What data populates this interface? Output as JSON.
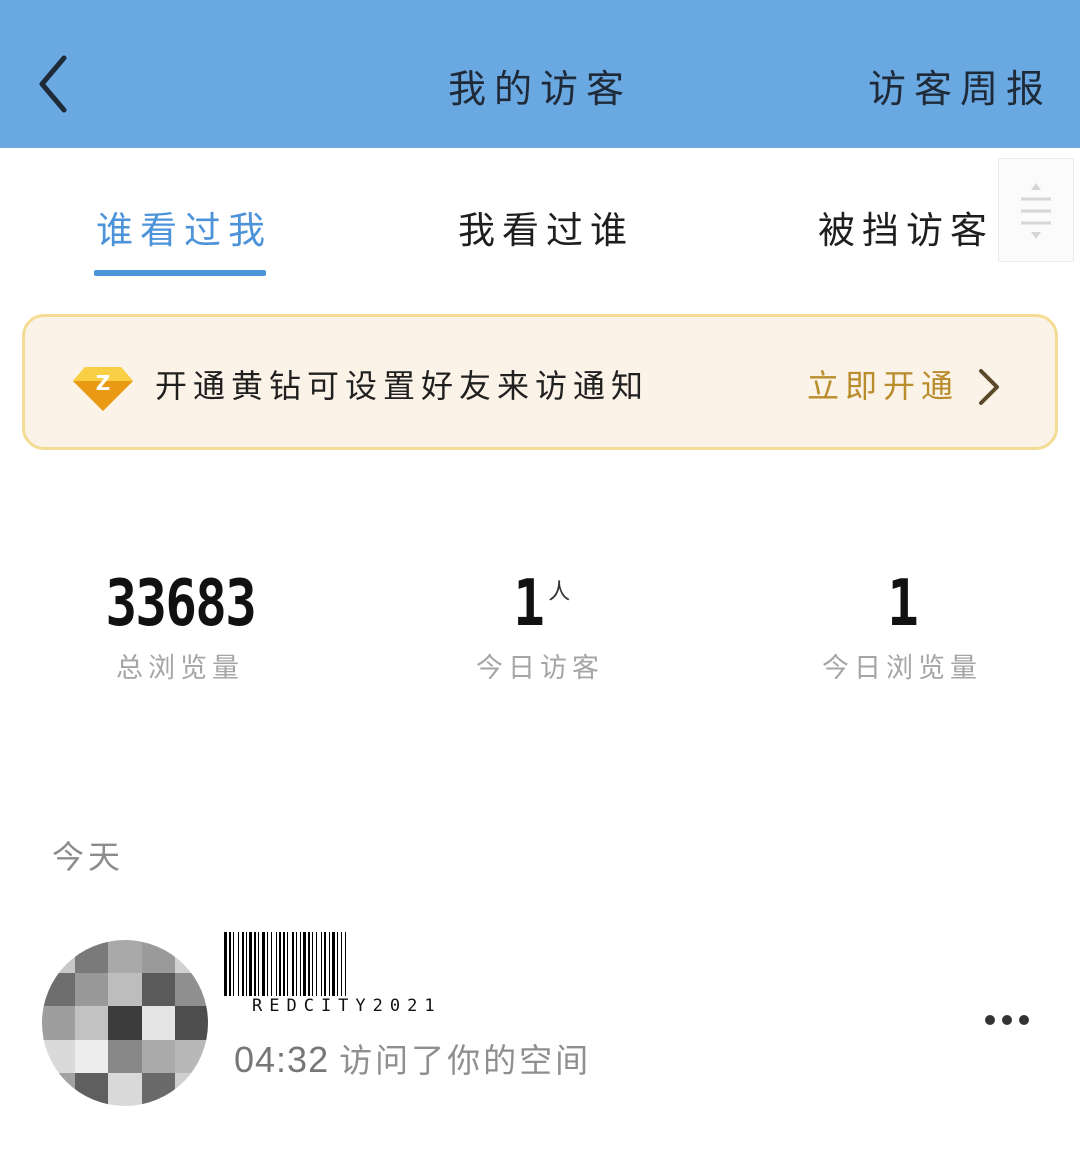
{
  "header": {
    "title": "我的访客",
    "right_action": "访客周报",
    "background": "#6aa8e2"
  },
  "tabs": [
    {
      "label": "谁看过我",
      "active": true
    },
    {
      "label": "我看过谁",
      "active": false
    },
    {
      "label": "被挡访客",
      "active": false
    }
  ],
  "banner": {
    "text": "开通黄钻可设置好友来访通知",
    "action": "立即开通",
    "accent": "#b98c2c"
  },
  "stats": [
    {
      "value": "33683",
      "unit": "",
      "label": "总浏览量"
    },
    {
      "value": "1",
      "unit": "人",
      "label": "今日访客"
    },
    {
      "value": "1",
      "unit": "",
      "label": "今日浏览量"
    }
  ],
  "section": {
    "label": "今天"
  },
  "visitor": {
    "watermark": "REDCITY2021",
    "time": "04:32",
    "action": "访问了你的空间"
  },
  "icons": {
    "back": "chevron-left-icon",
    "tab_menu": "sort-menu-icon",
    "banner": "yellow-diamond-icon",
    "banner_arrow": "chevron-right-icon",
    "more": "more-dots-icon"
  }
}
